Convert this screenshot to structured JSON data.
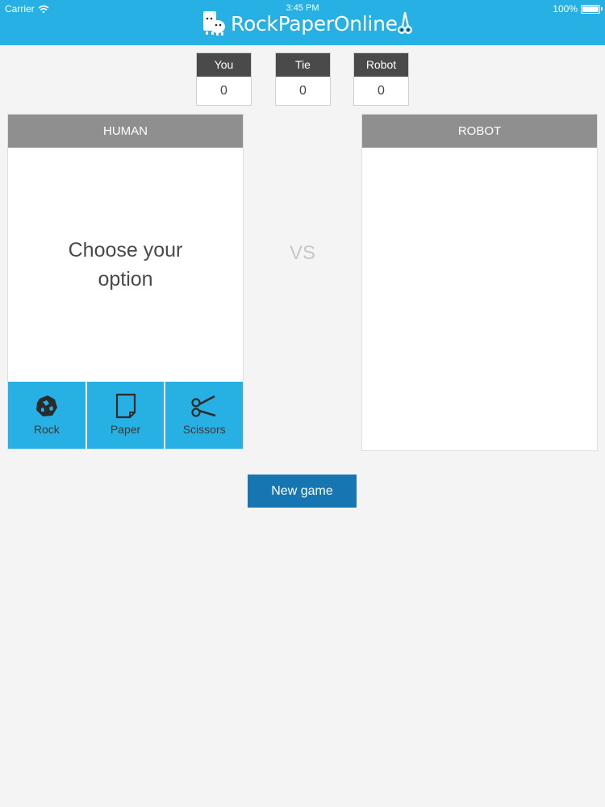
{
  "status_bar": {
    "carrier": "Carrier",
    "time": "3:45 PM",
    "battery": "100%"
  },
  "app": {
    "title": "RockPaperOnline"
  },
  "scores": [
    {
      "label": "You",
      "value": "0"
    },
    {
      "label": "Tie",
      "value": "0"
    },
    {
      "label": "Robot",
      "value": "0"
    }
  ],
  "human_panel": {
    "title": "HUMAN",
    "prompt_line1": "Choose your",
    "prompt_line2": "option",
    "options": [
      {
        "label": "Rock",
        "icon": "rock-icon"
      },
      {
        "label": "Paper",
        "icon": "paper-icon"
      },
      {
        "label": "Scissors",
        "icon": "scissors-icon"
      }
    ]
  },
  "vs_label": "VS",
  "robot_panel": {
    "title": "ROBOT"
  },
  "new_game_label": "New game",
  "colors": {
    "header": "#27b0e3",
    "option_button": "#27b0e3",
    "new_game_button": "#1676b1",
    "score_header": "#4a4a4a",
    "panel_header": "#8f8f8f",
    "background": "#f4f4f4"
  }
}
